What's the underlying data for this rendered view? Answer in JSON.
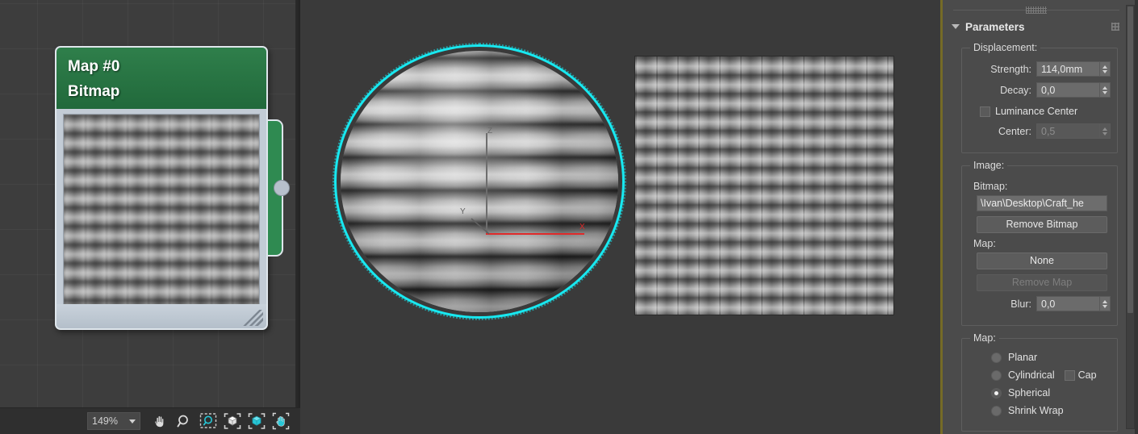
{
  "slate_editor": {
    "node": {
      "title": "Map #0",
      "subtitle": "Bitmap",
      "header_color": "#2f7f4b",
      "thumbnail_name": "woven-basket-texture"
    },
    "toolbar": {
      "zoom_value": "149%",
      "buttons": [
        {
          "name": "pan-tool",
          "icon": "hand-icon",
          "label": "Pan"
        },
        {
          "name": "zoom-tool",
          "icon": "magnifier-icon",
          "label": "Zoom"
        },
        {
          "name": "zoom-region-tool",
          "icon": "zoom-region-icon",
          "label": "Zoom Region"
        },
        {
          "name": "zoom-extents-tool",
          "icon": "zoom-extents-icon",
          "label": "Zoom Extents"
        },
        {
          "name": "zoom-extents-selected-tool",
          "icon": "zoom-extents-selected-icon",
          "label": "Zoom Extents Selected"
        },
        {
          "name": "pan-active-tool",
          "icon": "hand-active-icon",
          "label": "Pan Active"
        }
      ]
    }
  },
  "viewport": {
    "objects": [
      {
        "name": "displaced-sphere",
        "selected": true,
        "selection_color": "#18e8f0"
      },
      {
        "name": "displaced-plane",
        "selected": false
      }
    ],
    "gizmo": {
      "z_label": "Z",
      "y_label": "Y",
      "x_label": "X",
      "x_color": "#e02a2a",
      "z_color": "#6d6d6d",
      "y_color": "#5f5f5f"
    }
  },
  "command_panel": {
    "rollout": {
      "title": "Parameters",
      "expanded": true
    },
    "displacement": {
      "group_label": "Displacement:",
      "strength": {
        "label": "Strength:",
        "value": "114,0mm",
        "enabled": true
      },
      "decay": {
        "label": "Decay:",
        "value": "0,0",
        "enabled": true
      },
      "luminance_center": {
        "label": "Luminance Center",
        "checked": false
      },
      "center": {
        "label": "Center:",
        "value": "0,5",
        "enabled": false
      }
    },
    "image": {
      "group_label": "Image:",
      "bitmap_label": "Bitmap:",
      "bitmap_path": "\\Ivan\\Desktop\\Craft_he",
      "remove_bitmap_label": "Remove Bitmap",
      "map_label": "Map:",
      "map_value": "None",
      "remove_map_label": "Remove Map",
      "blur": {
        "label": "Blur:",
        "value": "0,0"
      }
    },
    "map": {
      "group_label": "Map:",
      "options": [
        {
          "label": "Planar",
          "selected": false
        },
        {
          "label": "Cylindrical",
          "selected": false
        },
        {
          "label": "Spherical",
          "selected": true
        },
        {
          "label": "Shrink Wrap",
          "selected": false
        }
      ],
      "cap": {
        "label": "Cap",
        "checked": false
      }
    }
  }
}
